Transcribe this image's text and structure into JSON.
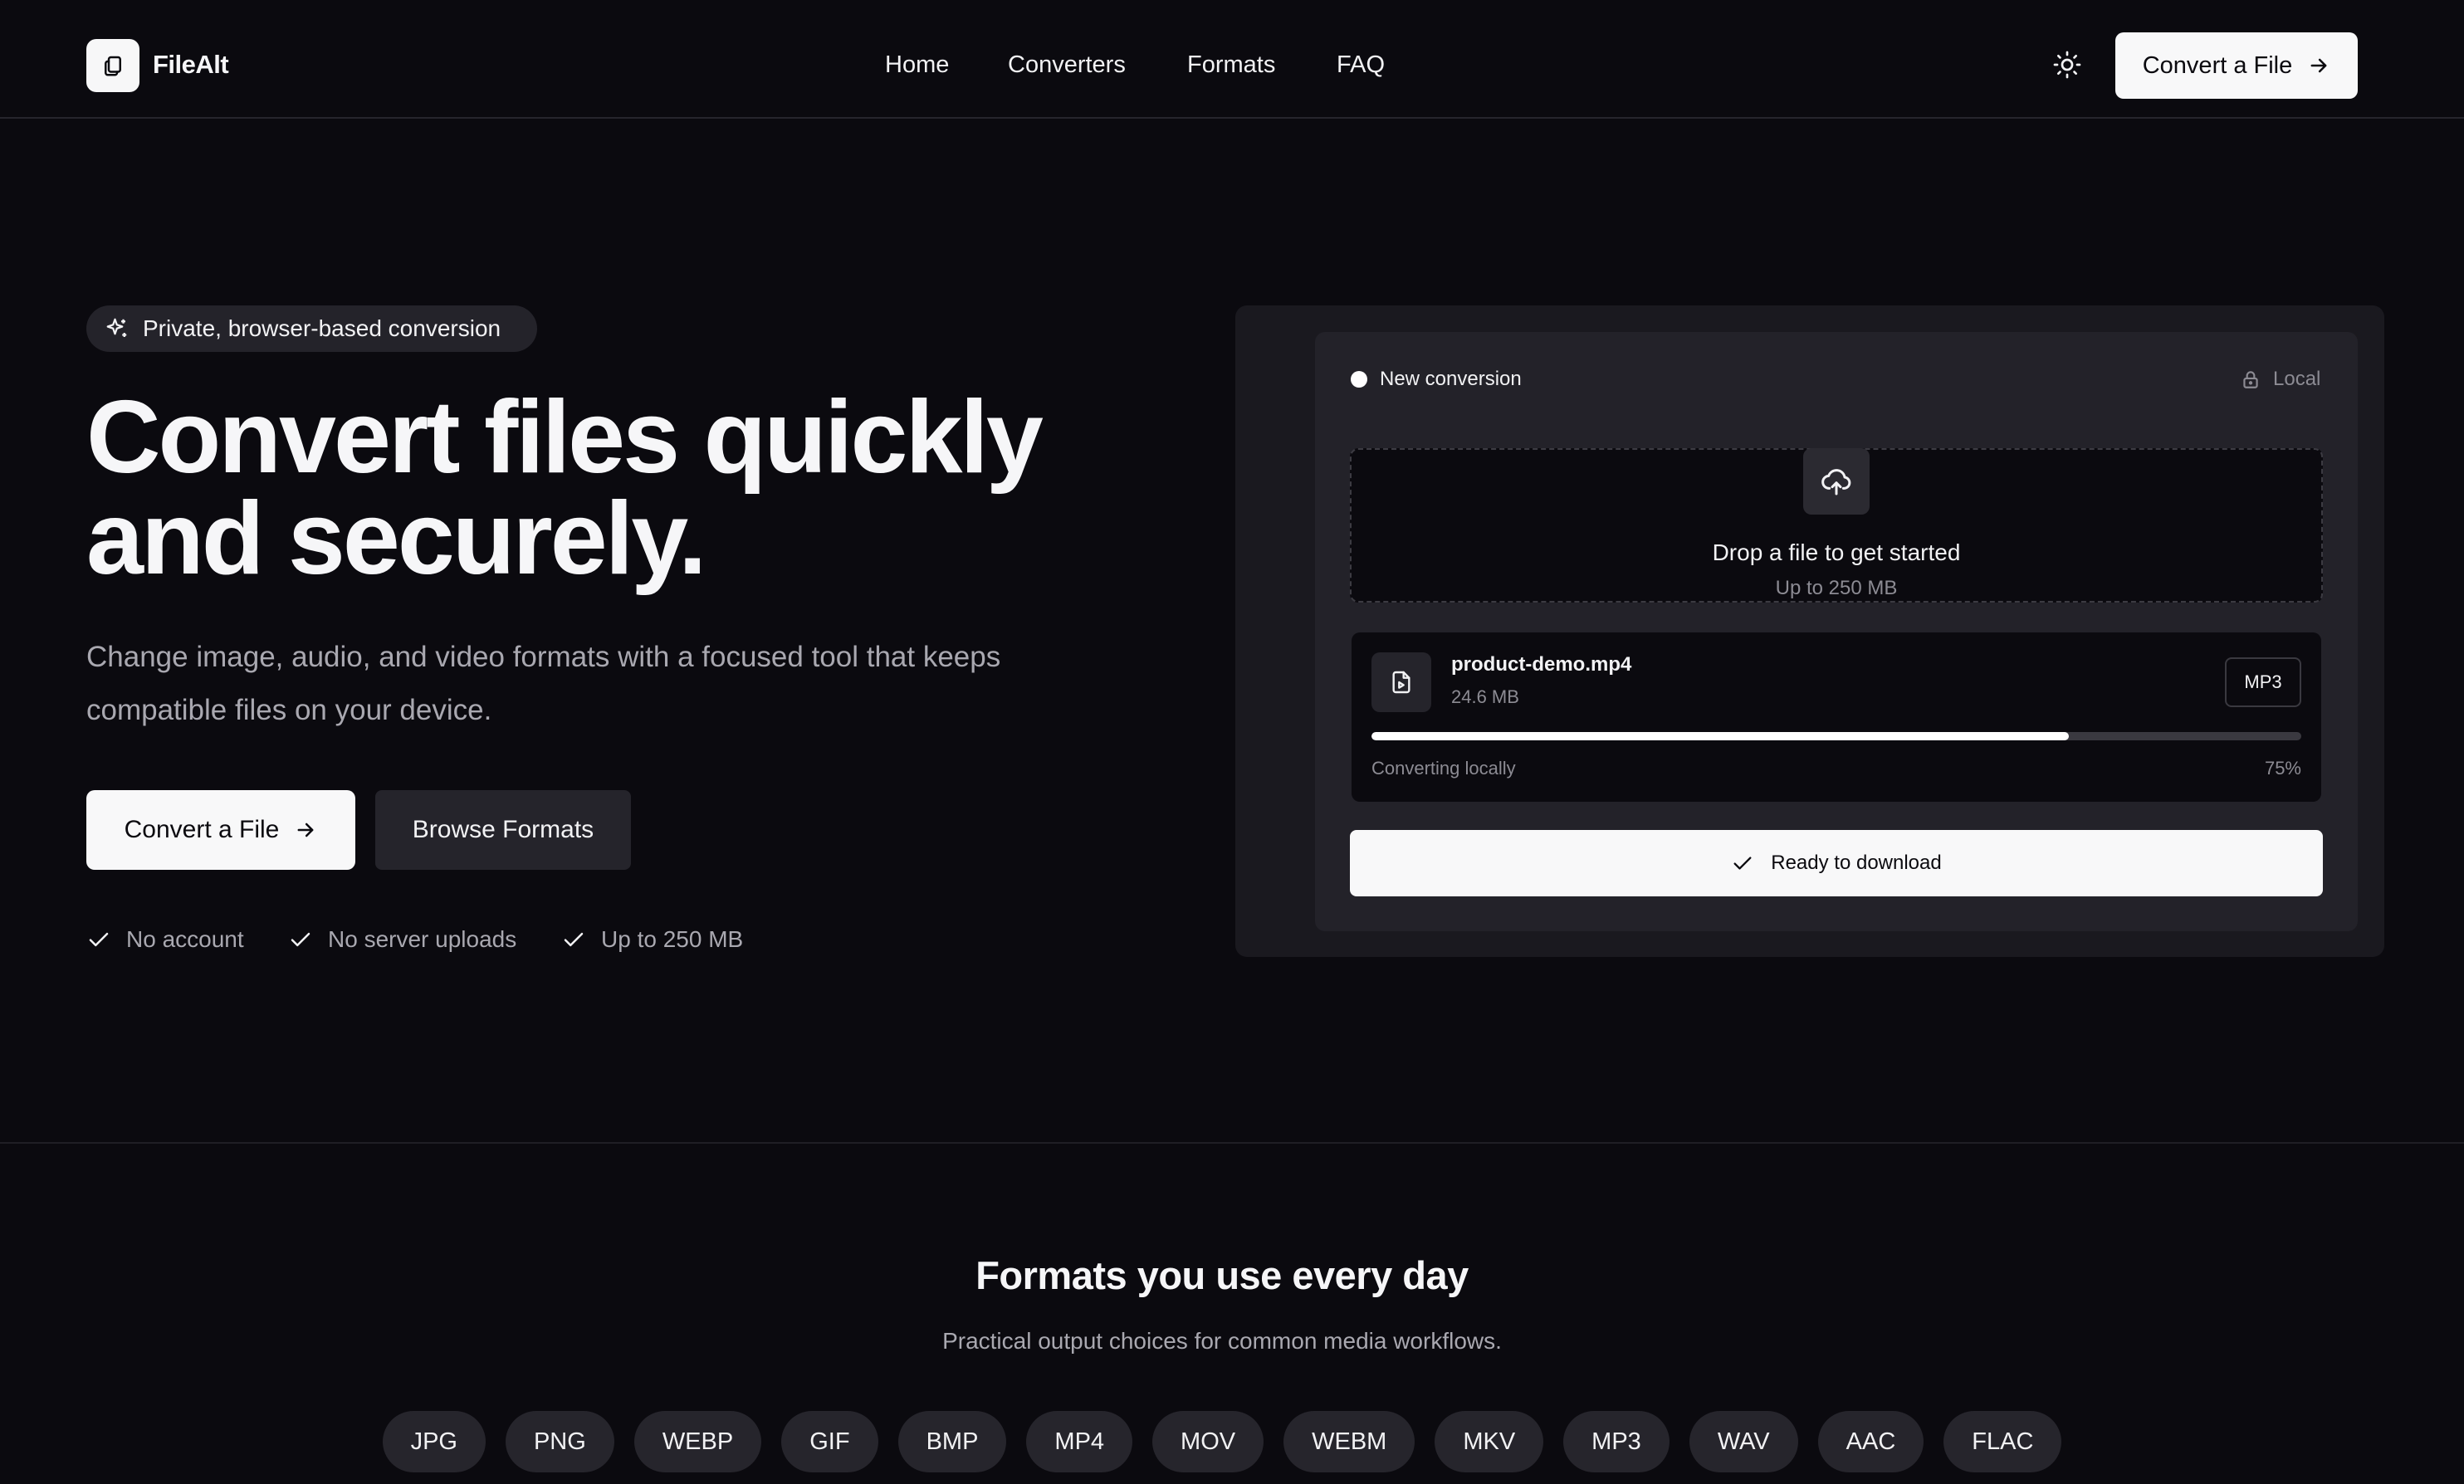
{
  "header": {
    "brand": "FileAlt",
    "nav": [
      "Home",
      "Converters",
      "Formats",
      "FAQ"
    ],
    "cta_label": "Convert a File"
  },
  "hero": {
    "badge": "Private, browser-based conversion",
    "headline_line1": "Convert files quickly",
    "headline_line2": "and securely.",
    "subtext": "Change image, audio, and video formats with a focused tool that keeps compatible files on your device.",
    "primary_cta": "Convert a File",
    "secondary_cta": "Browse Formats",
    "features": [
      "No account",
      "No server uploads",
      "Up to 250 MB"
    ]
  },
  "converter_card": {
    "status_label": "New conversion",
    "local_label": "Local",
    "dropzone": {
      "title": "Drop a file to get started",
      "subtitle": "Up to 250 MB"
    },
    "file": {
      "name": "product-demo.mp4",
      "size": "24.6 MB",
      "output_format": "MP3",
      "progress_label": "Converting locally",
      "progress_text": "75%",
      "progress_value": 0.75
    },
    "download_label": "Ready to download"
  },
  "formats_section": {
    "title": "Formats you use every day",
    "subtitle": "Practical output choices for common media workflows.",
    "chips": [
      "JPG",
      "PNG",
      "WEBP",
      "GIF",
      "BMP",
      "MP4",
      "MOV",
      "WEBM",
      "MKV",
      "MP3",
      "WAV",
      "AAC",
      "FLAC"
    ]
  },
  "colors": {
    "background": "#0b0a0f",
    "surface": "#1a191f",
    "surface_raised": "#232229",
    "chip": "#26252c",
    "text": "#f6f6f8",
    "muted": "#a9a8b0",
    "button_light": "#f8f8f9"
  }
}
